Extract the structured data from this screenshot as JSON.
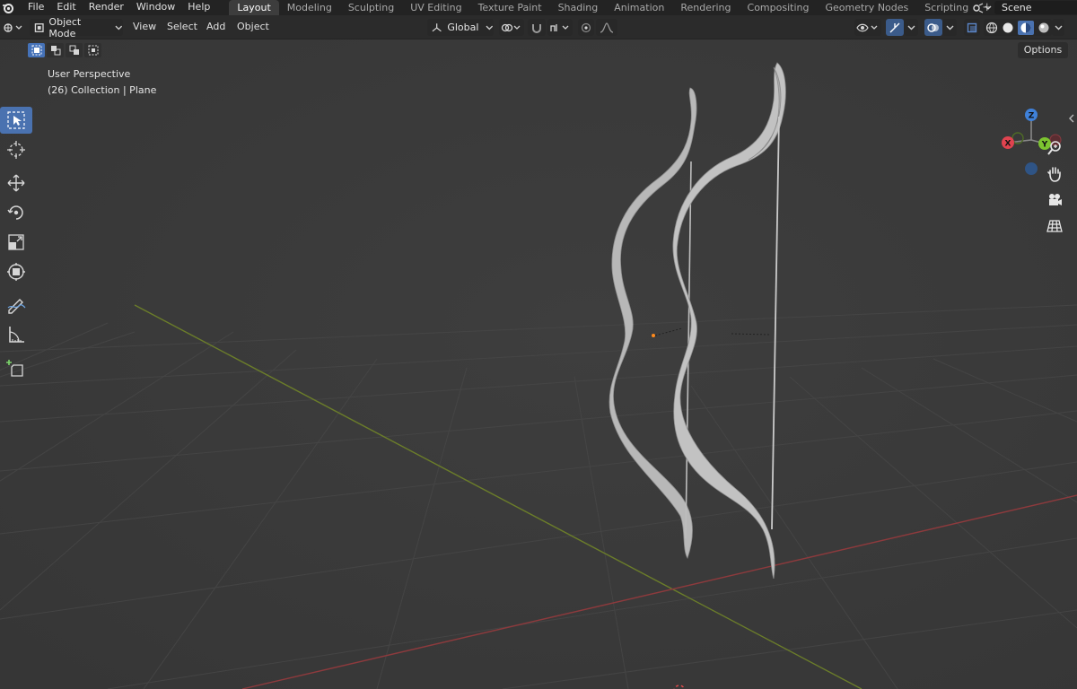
{
  "menu": {
    "items": [
      "File",
      "Edit",
      "Render",
      "Window",
      "Help"
    ]
  },
  "workspaces": {
    "tabs": [
      "Layout",
      "Modeling",
      "Sculpting",
      "UV Editing",
      "Texture Paint",
      "Shading",
      "Animation",
      "Rendering",
      "Compositing",
      "Geometry Nodes",
      "Scripting"
    ],
    "active": "Layout",
    "add_label": "+"
  },
  "scene": {
    "name": "Scene"
  },
  "header": {
    "mode": "Object Mode",
    "menus": [
      "View",
      "Select",
      "Add",
      "Object"
    ],
    "orientation": "Global",
    "options_label": "Options"
  },
  "viewport": {
    "view_name": "User Perspective",
    "collection_info": "(26) Collection | Plane"
  },
  "gizmo": {
    "axes": {
      "x": "X",
      "y": "Y",
      "z": "Z"
    },
    "colors": {
      "x": "#e0434f",
      "y": "#7cc430",
      "z": "#3f81d9"
    }
  },
  "icons": {
    "toolbar": [
      "select-box-icon",
      "cursor-icon",
      "move-icon",
      "rotate-icon",
      "scale-icon",
      "transform-icon",
      "annotate-icon",
      "measure-icon",
      "add-cube-icon"
    ],
    "nav": [
      "zoom-icon",
      "hand-icon",
      "camera-icon",
      "grid-icon"
    ]
  }
}
